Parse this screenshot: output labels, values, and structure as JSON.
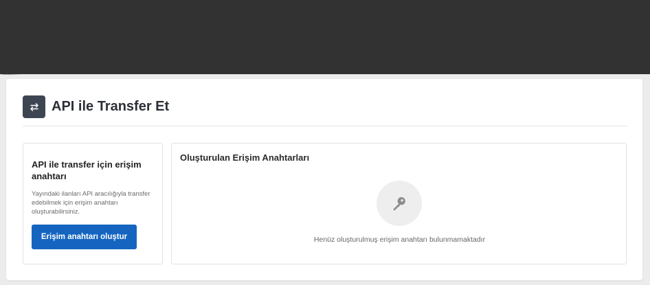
{
  "header": {
    "icon": "transfer-arrows-icon",
    "title": "API ile Transfer Et"
  },
  "left_panel": {
    "title": "API ile transfer için erişim anahtarı",
    "description": "Yayındaki ilanları API aracılığıyla transfer edebilmek için erişim anahtarı oluşturabilirsiniz.",
    "button_label": "Erişim anahtarı oluştur"
  },
  "right_panel": {
    "title": "Oluşturulan Erişim Anahtarları",
    "icon": "key-icon",
    "empty_message": "Henüz oluşturulmuş erişim anahtarı bulunmamaktadır"
  },
  "colors": {
    "top_band": "#323232",
    "primary_button": "#1565c0",
    "header_icon_bg": "#3d4552"
  }
}
